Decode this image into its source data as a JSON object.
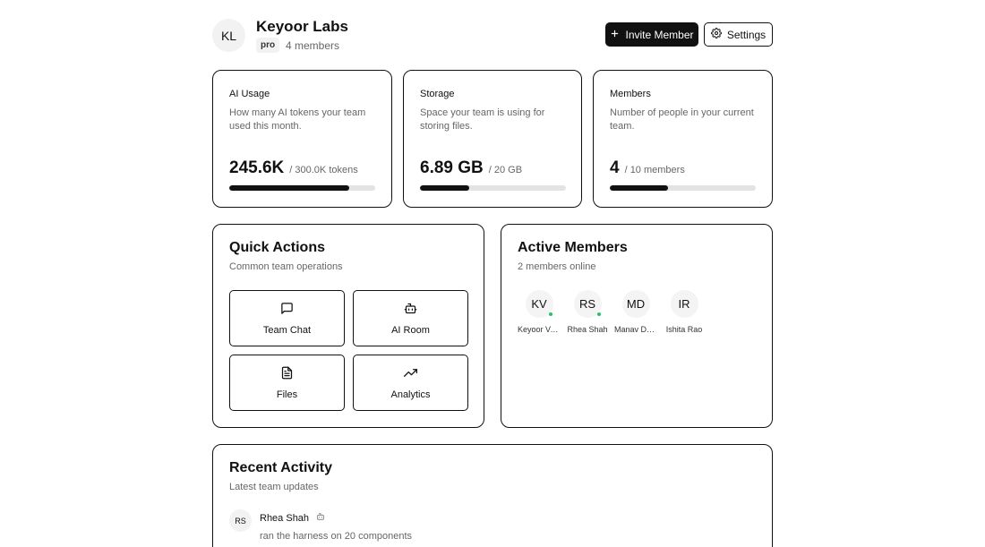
{
  "team": {
    "initials": "KL",
    "name": "Keyoor Labs",
    "plan": "pro",
    "member_count": "4 members"
  },
  "header": {
    "invite_label": "Invite Member",
    "settings_label": "Settings"
  },
  "stats": [
    {
      "title": "AI Usage",
      "description": "How many AI tokens your team used this month.",
      "value": "245.6K",
      "limit": "/ 300.0K tokens",
      "progress": 0.82
    },
    {
      "title": "Storage",
      "description": "Space your team is using for storing files.",
      "value": "6.89 GB",
      "limit": "/ 20 GB",
      "progress": 0.34
    },
    {
      "title": "Members",
      "description": "Number of people in your current team.",
      "value": "4",
      "limit": "/ 10 members",
      "progress": 0.4
    }
  ],
  "quick_actions": {
    "title": "Quick Actions",
    "subtitle": "Common team operations",
    "items": [
      {
        "label": "Team Chat",
        "icon": "message-square-icon"
      },
      {
        "label": "AI Room",
        "icon": "bot-icon"
      },
      {
        "label": "Files",
        "icon": "file-text-icon"
      },
      {
        "label": "Analytics",
        "icon": "trending-up-icon"
      }
    ]
  },
  "active_members": {
    "title": "Active Members",
    "subtitle": "2 members online",
    "members": [
      {
        "initials": "KV",
        "name": "Keyoor Vaghela",
        "online": true
      },
      {
        "initials": "RS",
        "name": "Rhea Shah",
        "online": true
      },
      {
        "initials": "MD",
        "name": "Manav Desai",
        "online": false
      },
      {
        "initials": "IR",
        "name": "Ishita Rao",
        "online": false
      }
    ]
  },
  "recent_activity": {
    "title": "Recent Activity",
    "subtitle": "Latest team updates",
    "items": [
      {
        "initials": "RS",
        "user": "Rhea Shah",
        "icon": "bot-icon",
        "text": "ran the harness on 20 components"
      }
    ]
  },
  "colors": {
    "accent": "#111111",
    "online": "#22c55e",
    "muted_text": "#666666",
    "track": "#e3e3e3"
  }
}
